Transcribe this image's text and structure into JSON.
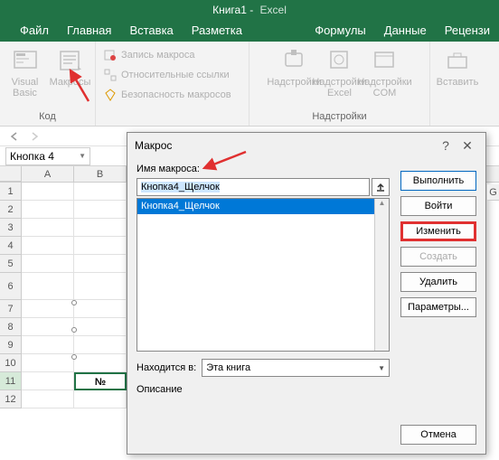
{
  "title": {
    "doc": "Книга1",
    "app": "Excel"
  },
  "tabs": [
    "Файл",
    "Главная",
    "Вставка",
    "Разметка страницы",
    "Формулы",
    "Данные",
    "Рецензи"
  ],
  "ribbon": {
    "code": {
      "visual_basic": "Visual\nBasic",
      "macros": "Макросы",
      "record": "Запись макроса",
      "relative": "Относительные ссылки",
      "security": "Безопасность макросов",
      "group": "Код"
    },
    "addins": {
      "addins": "Надстройки",
      "excel_addins": "Надстройки\nExcel",
      "com_addins": "Надстройки\nCOM",
      "group": "Надстройки"
    },
    "controls": {
      "insert": "Вставить"
    }
  },
  "name_box": "Кнопка 4",
  "columns": [
    "A",
    "B",
    "G"
  ],
  "rows": [
    "1",
    "2",
    "3",
    "4",
    "5",
    "6",
    "7",
    "8",
    "9",
    "10",
    "11",
    "12"
  ],
  "cell_value": "№",
  "dialog": {
    "title": "Макрос",
    "name_label": "Имя макроса:",
    "name_value": "Кнопка4_Щелчок",
    "list": [
      "Кнопка4_Щелчок"
    ],
    "location_label": "Находится в:",
    "location_value": "Эта книга",
    "description_label": "Описание",
    "buttons": {
      "run": "Выполнить",
      "step": "Войти",
      "edit": "Изменить",
      "create": "Создать",
      "delete": "Удалить",
      "options": "Параметры...",
      "cancel": "Отмена"
    }
  }
}
